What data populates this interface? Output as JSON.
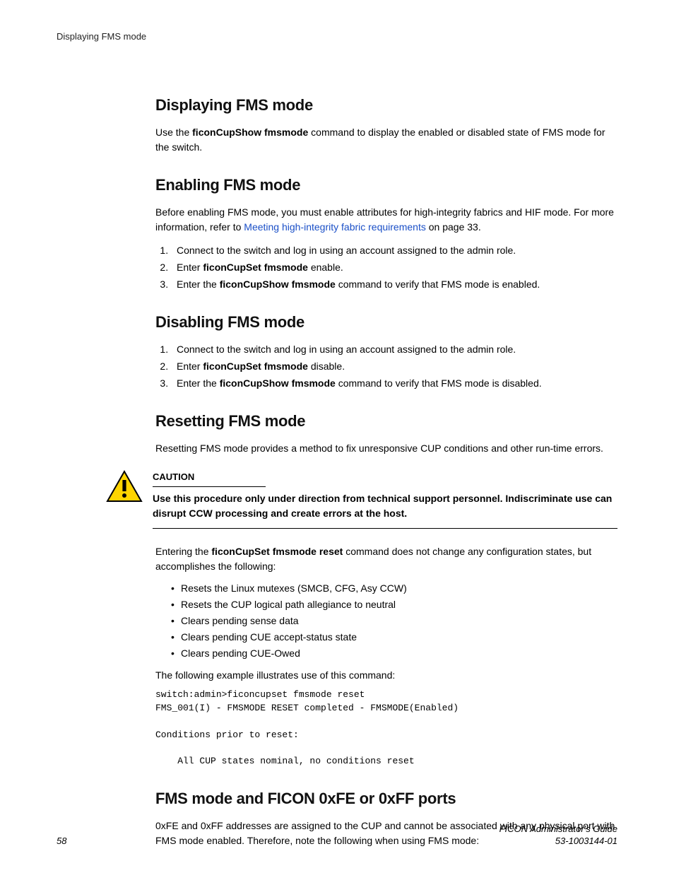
{
  "header": {
    "running": "Displaying FMS mode"
  },
  "sections": {
    "displaying": {
      "title": "Displaying FMS mode",
      "p1a": "Use the ",
      "p1b": "ficonCupShow fmsmode",
      "p1c": " command to display the enabled or disabled state of FMS mode for the switch."
    },
    "enabling": {
      "title": "Enabling FMS mode",
      "introA": "Before enabling FMS mode, you must enable attributes for high-integrity fabrics and HIF mode. For more information, refer to ",
      "introLink": "Meeting high-integrity fabric requirements",
      "introB": " on page 33.",
      "step1": "Connect to the switch and log in using an account assigned to the admin role.",
      "step2a": "Enter ",
      "step2b": "ficonCupSet fmsmode",
      "step2c": " enable.",
      "step3a": "Enter the ",
      "step3b": "ficonCupShow fmsmode",
      "step3c": " command to verify that FMS mode is enabled."
    },
    "disabling": {
      "title": "Disabling FMS mode",
      "step1": "Connect to the switch and log in using an account assigned to the admin role.",
      "step2a": "Enter ",
      "step2b": "ficonCupSet fmsmode",
      "step2c": " disable.",
      "step3a": "Enter the ",
      "step3b": "ficonCupShow fmsmode",
      "step3c": " command to verify that FMS mode is disabled."
    },
    "resetting": {
      "title": "Resetting FMS mode",
      "intro": "Resetting FMS mode provides a method to fix unresponsive CUP conditions and other run-time errors.",
      "cautionLabel": "CAUTION",
      "cautionText": "Use this procedure only under direction from technical support personnel. Indiscriminate use can disrupt CCW processing and create errors at the host.",
      "afterCautionA": "Entering the ",
      "afterCautionB": "ficonCupSet fmsmode reset",
      "afterCautionC": " command does not change any configuration states, but accomplishes the following:",
      "bullets": {
        "b1": "Resets the Linux mutexes (SMCB, CFG, Asy CCW)",
        "b2": "Resets the CUP logical path allegiance to neutral",
        "b3": "Clears pending sense data",
        "b4": "Clears pending CUE accept-status state",
        "b5": "Clears pending CUE-Owed"
      },
      "exampleLead": "The following example illustrates use of this command:",
      "code": "switch:admin>ficoncupset fmsmode reset\nFMS_001(I) - FMSMODE RESET completed - FMSMODE(Enabled)\n\nConditions prior to reset:\n\n    All CUP states nominal, no conditions reset"
    },
    "oxfe": {
      "title": "FMS mode and FICON 0xFE or 0xFF ports",
      "p1": "0xFE and 0xFF addresses are assigned to the CUP and cannot be associated with any physical port with FMS mode enabled. Therefore, note the following when using FMS mode:"
    }
  },
  "footer": {
    "pageNumber": "58",
    "guide": "FICON Administrator's Guide",
    "docnum": "53-1003144-01"
  }
}
